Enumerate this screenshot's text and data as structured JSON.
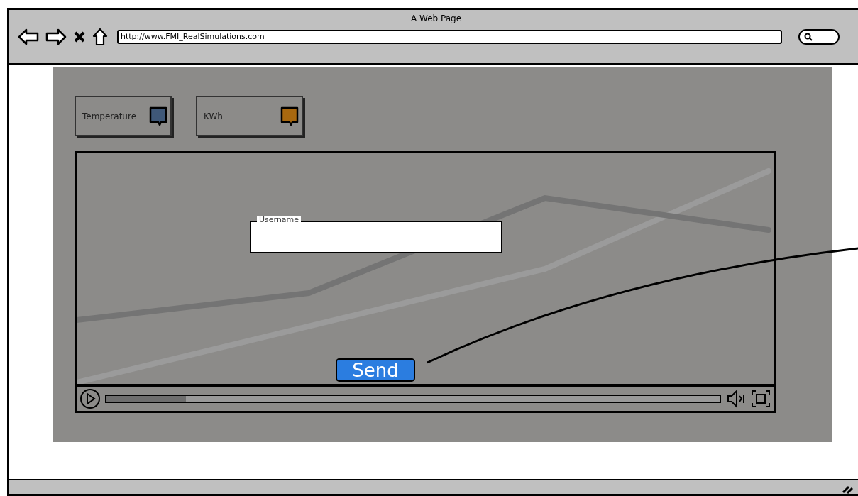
{
  "window": {
    "title": "A Web Page"
  },
  "address_bar": {
    "value": "http://www.FMI_RealSimulations.com"
  },
  "widgets": [
    {
      "label": "Temperature",
      "color": "#3f5878"
    },
    {
      "label": "KWh",
      "color": "#a8680f"
    }
  ],
  "form": {
    "field_label": "Username",
    "button": "Send"
  },
  "video": {
    "progress": {
      "level": 0.13
    }
  }
}
